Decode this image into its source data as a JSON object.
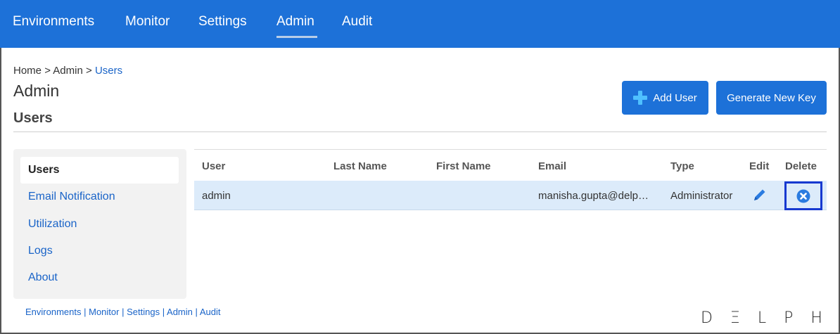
{
  "topnav": {
    "items": [
      "Environments",
      "Monitor",
      "Settings",
      "Admin",
      "Audit"
    ],
    "active": "Admin"
  },
  "breadcrumb": {
    "home": "Home",
    "sep": ">",
    "admin": "Admin",
    "current": "Users"
  },
  "page": {
    "title": "Admin",
    "section": "Users"
  },
  "buttons": {
    "add_user": "Add User",
    "generate_key": "Generate New Key"
  },
  "sidebar": {
    "items": [
      "Users",
      "Email Notification",
      "Utilization",
      "Logs",
      "About"
    ],
    "active": "Users"
  },
  "table": {
    "columns": [
      "User",
      "Last Name",
      "First Name",
      "Email",
      "Type",
      "Edit",
      "Delete"
    ],
    "rows": [
      {
        "user": "admin",
        "last_name": "",
        "first_name": "",
        "email": "manisha.gupta@delp…",
        "type": "Administrator"
      }
    ]
  },
  "footer": {
    "links": [
      "Environments",
      "Monitor",
      "Settings",
      "Admin",
      "Audit"
    ],
    "separator": "|"
  },
  "logo": {
    "text": "D Ξ L P H I X"
  },
  "colors": {
    "brand_blue": "#1d71d8",
    "link_blue": "#1a64c8",
    "row_highlight": "#dcebfa",
    "highlight_border": "#1739d0"
  }
}
